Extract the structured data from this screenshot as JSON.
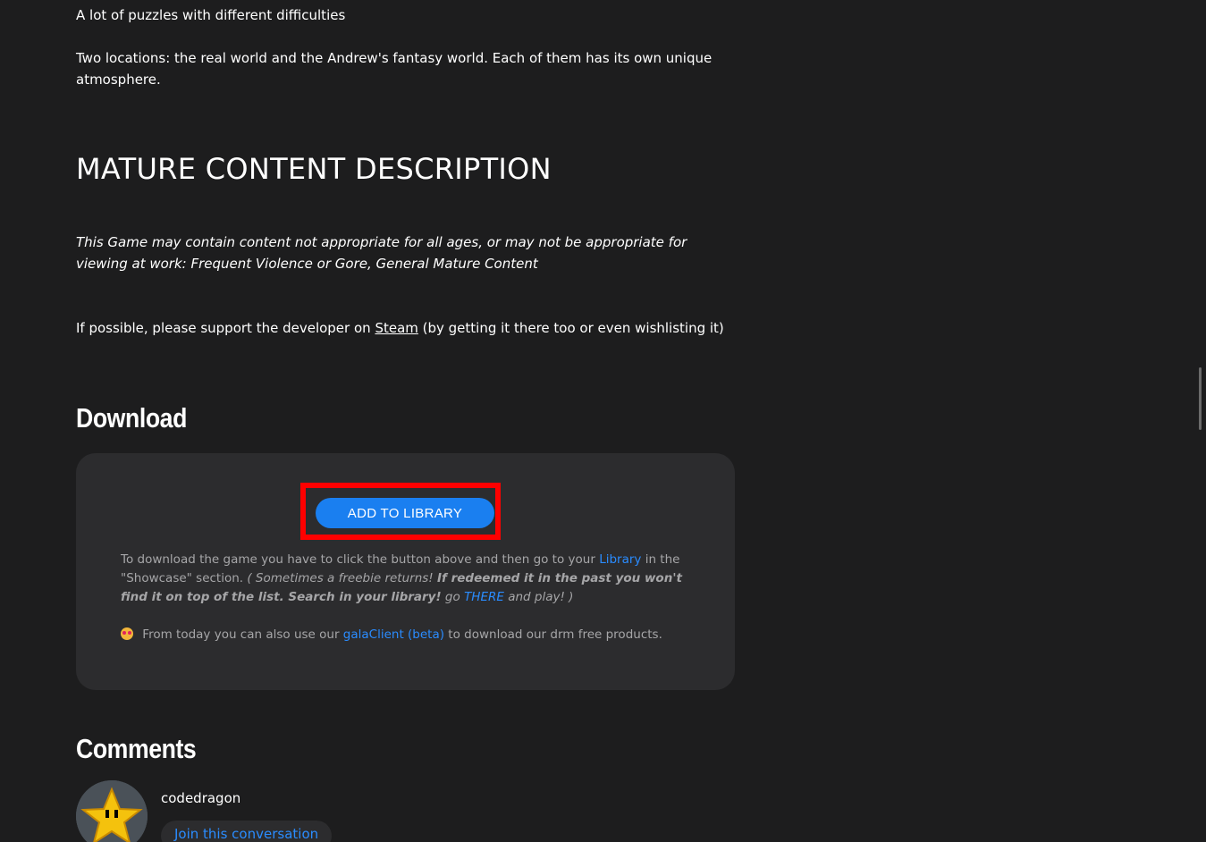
{
  "features": {
    "line1": "A lot of puzzles with different difficulties",
    "line2": "Two locations: the real world and the Andrew's fantasy world. Each of them has its own unique atmosphere."
  },
  "mature": {
    "heading": "MATURE CONTENT DESCRIPTION",
    "description": "This Game may contain content not appropriate for all ages, or may not be appropriate for viewing at work: Frequent Violence or Gore, General Mature Content"
  },
  "support": {
    "prefix": "If possible, please support the developer on ",
    "link": "Steam",
    "suffix": " (by getting it there too or even wishlisting it)"
  },
  "download": {
    "heading": "Download",
    "add_button": "ADD TO LIBRARY",
    "text_part1": "To download the game you have to click the button above and then go to your ",
    "library_link": "Library",
    "text_part2": " in the \"Showcase\" section. ",
    "italic1": "( Sometimes a freebie returns! ",
    "bolditalic": "If redeemed it in the past you won't find it on top of the list. Search in your library!",
    "italic2": " go ",
    "there_link": "THERE",
    "italic3": " and play! )",
    "client_prefix": " From today you can also use our ",
    "client_link": "galaClient (beta)",
    "client_suffix": " to download our drm free products."
  },
  "comments": {
    "heading": "Comments",
    "username": "codedragon",
    "join_button": "Join this conversation"
  },
  "colors": {
    "background": "#1d1d1e",
    "box": "#2c2c2e",
    "accent": "#1a7ff0",
    "link": "#2a8cff",
    "highlight": "#ff0000"
  }
}
